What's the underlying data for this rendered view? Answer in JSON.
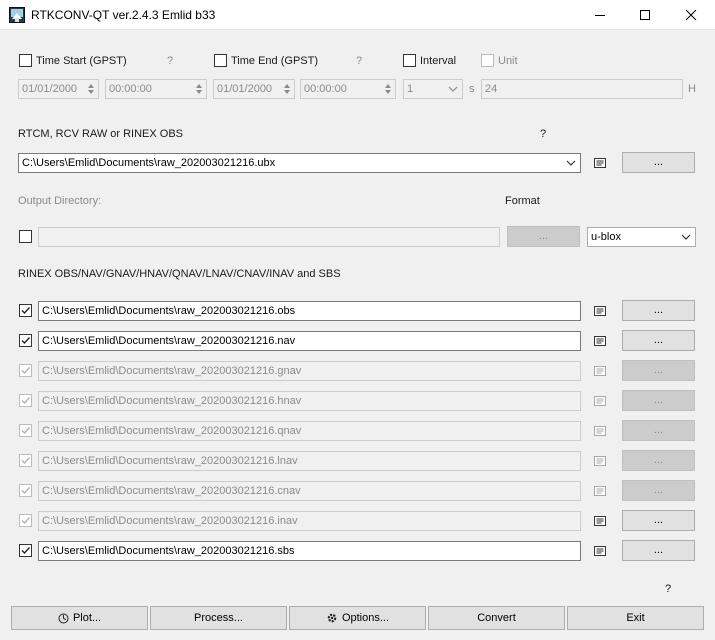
{
  "window": {
    "title": "RTKCONV-QT ver.2.4.3 Emlid b33"
  },
  "time_row": {
    "time_start_label": "Time Start (GPST)",
    "time_start_help": "?",
    "time_end_label": "Time End (GPST)",
    "time_end_help": "?",
    "interval_label": "Interval",
    "unit_label": "Unit",
    "start_date": "01/01/2000",
    "start_time": "00:00:00",
    "end_date": "01/01/2000",
    "end_time": "00:00:00",
    "interval_value": "1",
    "interval_unit": "s",
    "unit_value": "24",
    "unit_suffix": "H"
  },
  "input": {
    "label": "RTCM, RCV RAW or RINEX OBS",
    "help": "?",
    "file": "C:\\Users\\Emlid\\Documents\\raw_202003021216.ubx",
    "browse_label": "..."
  },
  "output": {
    "dir_label": "Output Directory:",
    "format_label": "Format",
    "dir_value": "",
    "browse_label": "...",
    "format_value": "u-blox"
  },
  "rinex": {
    "label": "RINEX OBS/NAV/GNAV/HNAV/QNAV/LNAV/CNAV/INAV and SBS",
    "rows": [
      {
        "file": "C:\\Users\\Emlid\\Documents\\raw_202003021216.obs",
        "browse": "...",
        "enabled": true
      },
      {
        "file": "C:\\Users\\Emlid\\Documents\\raw_202003021216.nav",
        "browse": "...",
        "enabled": true
      },
      {
        "file": "C:\\Users\\Emlid\\Documents\\raw_202003021216.gnav",
        "browse": "...",
        "enabled": false
      },
      {
        "file": "C:\\Users\\Emlid\\Documents\\raw_202003021216.hnav",
        "browse": "...",
        "enabled": false
      },
      {
        "file": "C:\\Users\\Emlid\\Documents\\raw_202003021216.qnav",
        "browse": "...",
        "enabled": false
      },
      {
        "file": "C:\\Users\\Emlid\\Documents\\raw_202003021216.lnav",
        "browse": "...",
        "enabled": false
      },
      {
        "file": "C:\\Users\\Emlid\\Documents\\raw_202003021216.cnav",
        "browse": "...",
        "enabled": false
      },
      {
        "file": "C:\\Users\\Emlid\\Documents\\raw_202003021216.inav",
        "browse": "...",
        "enabled": false
      },
      {
        "file": "C:\\Users\\Emlid\\Documents\\raw_202003021216.sbs",
        "browse": "...",
        "enabled": true
      }
    ]
  },
  "footer": {
    "help": "?",
    "plot_label": "Plot...",
    "process_label": "Process...",
    "options_label": "Options...",
    "convert_label": "Convert",
    "exit_label": "Exit"
  },
  "icons": {
    "app": "rtkconv-app-icon",
    "plot": "plot-icon",
    "options": "gear-icon",
    "view_file": "view-file-icon"
  }
}
